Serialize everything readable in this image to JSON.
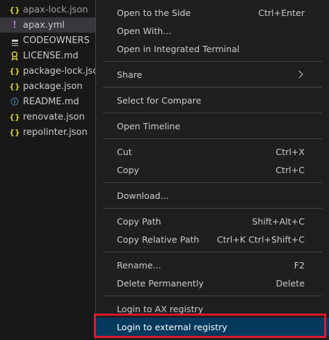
{
  "explorer": {
    "files": [
      {
        "name": "apax-lock.json",
        "icon": "json-braces-icon"
      },
      {
        "name": "apax.yml",
        "icon": "yaml-exclamation-icon"
      },
      {
        "name": "CODEOWNERS",
        "icon": "text-lines-icon"
      },
      {
        "name": "LICENSE.md",
        "icon": "license-ribbon-icon"
      },
      {
        "name": "package-lock.json",
        "icon": "json-braces-icon"
      },
      {
        "name": "package.json",
        "icon": "json-braces-icon"
      },
      {
        "name": "README.md",
        "icon": "info-icon"
      },
      {
        "name": "renovate.json",
        "icon": "json-braces-icon"
      },
      {
        "name": "repolinter.json",
        "icon": "json-braces-icon"
      }
    ],
    "icon_glyphs": {
      "json": "{}",
      "yml": "!",
      "info": "ⓘ"
    }
  },
  "context_menu": {
    "open_to_side": {
      "label": "Open to the Side",
      "shortcut": "Ctrl+Enter"
    },
    "open_with": {
      "label": "Open With..."
    },
    "open_in_terminal": {
      "label": "Open in Integrated Terminal"
    },
    "share": {
      "label": "Share"
    },
    "select_for_compare": {
      "label": "Select for Compare"
    },
    "open_timeline": {
      "label": "Open Timeline"
    },
    "cut": {
      "label": "Cut",
      "shortcut": "Ctrl+X"
    },
    "copy": {
      "label": "Copy",
      "shortcut": "Ctrl+C"
    },
    "download": {
      "label": "Download..."
    },
    "copy_path": {
      "label": "Copy Path",
      "shortcut": "Shift+Alt+C"
    },
    "copy_relative_path": {
      "label": "Copy Relative Path",
      "shortcut": "Ctrl+K Ctrl+Shift+C"
    },
    "rename": {
      "label": "Rename...",
      "shortcut": "F2"
    },
    "delete_permanently": {
      "label": "Delete Permanently",
      "shortcut": "Delete"
    },
    "login_ax_registry": {
      "label": "Login to AX registry"
    },
    "login_external_registry": {
      "label": "Login to external registry"
    }
  },
  "colors": {
    "background": "#181818",
    "menu_background": "#1f1f1f",
    "highlight": "#04395e",
    "annotation_border": "#e0182d",
    "json_icon": "#cbcb41",
    "yml_icon": "#a074c4",
    "info_icon": "#519aba"
  }
}
